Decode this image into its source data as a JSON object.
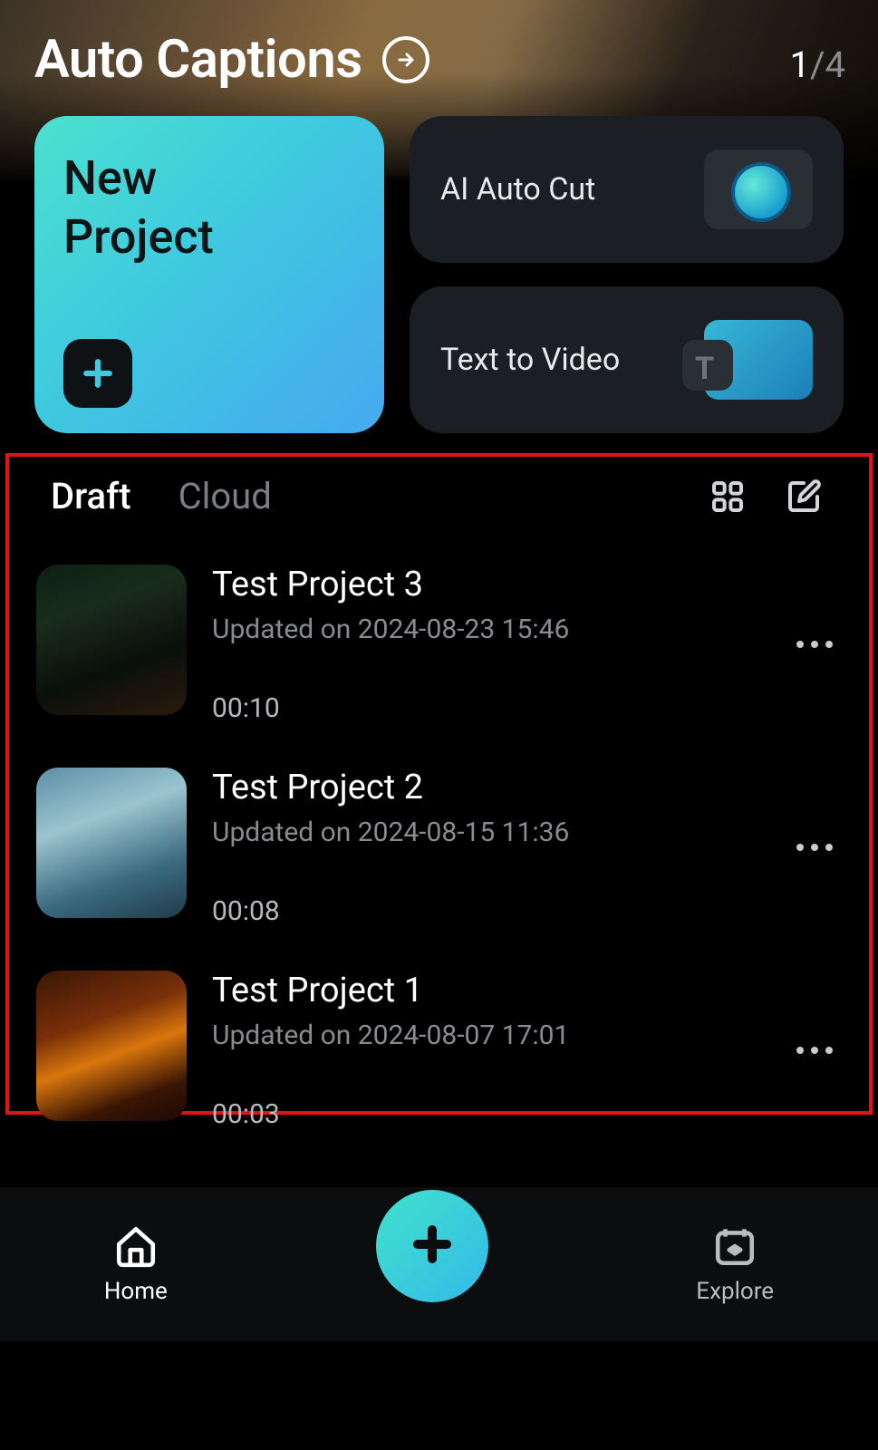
{
  "hero": {
    "title": "Auto Captions",
    "page_current": "1",
    "page_total": "4"
  },
  "actions": {
    "new_project": "New\nProject",
    "ai_auto_cut": "AI Auto Cut",
    "text_to_video": "Text to Video"
  },
  "tabs": {
    "draft": "Draft",
    "cloud": "Cloud"
  },
  "projects": [
    {
      "name": "Test Project 3",
      "updated": "Updated on 2024-08-23 15:46",
      "duration": "00:10"
    },
    {
      "name": "Test Project 2",
      "updated": "Updated on 2024-08-15 11:36",
      "duration": "00:08"
    },
    {
      "name": "Test Project 1",
      "updated": "Updated on 2024-08-07 17:01",
      "duration": "00:03"
    }
  ],
  "nav": {
    "home": "Home",
    "explore": "Explore"
  }
}
